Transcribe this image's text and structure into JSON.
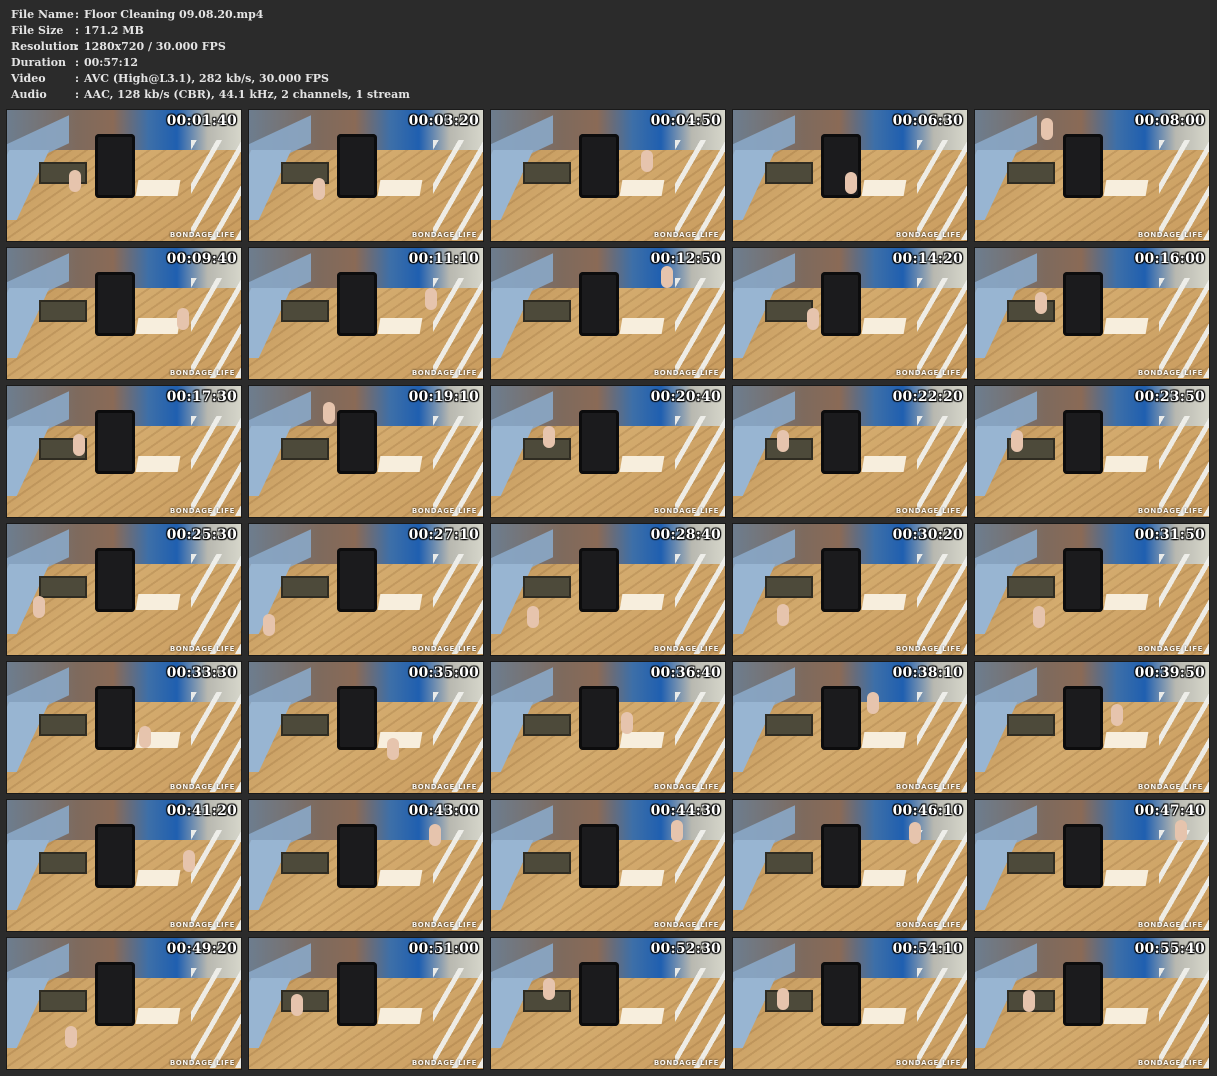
{
  "info": [
    {
      "label": "File Name",
      "sep": ":",
      "value": "Floor Cleaning 09.08.20.mp4"
    },
    {
      "label": "File Size",
      "sep": ":",
      "value": "171.2 MB"
    },
    {
      "label": "Resolution",
      "sep": ":",
      "value": "1280x720 / 30.000 FPS"
    },
    {
      "label": "Duration",
      "sep": ":",
      "value": "00:57:12"
    },
    {
      "label": "Video",
      "sep": ":",
      "value": "AVC (High@L3.1), 282 kb/s, 30.000 FPS"
    },
    {
      "label": "Audio",
      "sep": ":",
      "value": "AAC, 128 kb/s (CBR), 44.1 kHz, 2 channels, 1 stream"
    }
  ],
  "watermark": "BONDAGE LIFE",
  "thumbnails": [
    "00:01:40",
    "00:03:20",
    "00:04:50",
    "00:06:30",
    "00:08:00",
    "00:09:40",
    "00:11:10",
    "00:12:50",
    "00:14:20",
    "00:16:00",
    "00:17:30",
    "00:19:10",
    "00:20:40",
    "00:22:20",
    "00:23:50",
    "00:25:30",
    "00:27:10",
    "00:28:40",
    "00:30:20",
    "00:31:50",
    "00:33:30",
    "00:35:00",
    "00:36:40",
    "00:38:10",
    "00:39:50",
    "00:41:20",
    "00:43:00",
    "00:44:30",
    "00:46:10",
    "00:47:40",
    "00:49:20",
    "00:51:00",
    "00:52:30",
    "00:54:10",
    "00:55:40"
  ]
}
